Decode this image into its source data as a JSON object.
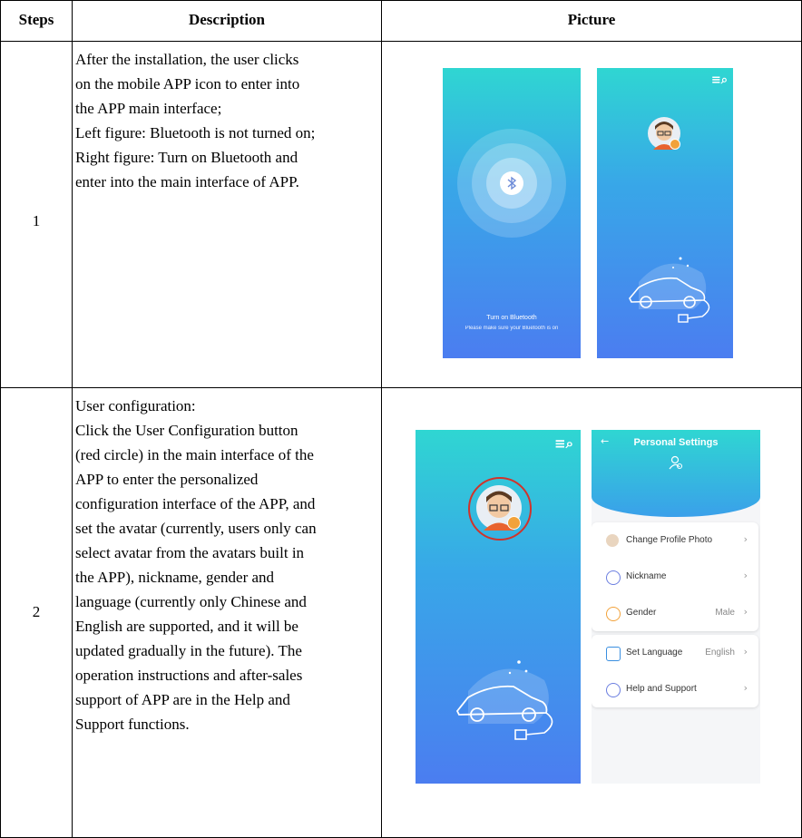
{
  "table": {
    "headers": {
      "steps": "Steps",
      "description": "Description",
      "picture": "Picture"
    },
    "rows": [
      {
        "step": "1",
        "description": "After the installation, the user clicks\non the mobile APP icon to enter into\nthe APP main interface;\nLeft figure: Bluetooth is not turned on;\nRight figure: Turn on Bluetooth and\nenter into the main interface of APP."
      },
      {
        "step": "2",
        "description": "User configuration:\nClick the User Configuration button\n(red circle) in the main interface of the\nAPP to enter the personalized\nconfiguration interface of the APP, and\nset the avatar (currently, users only can\nselect avatar from the avatars built in\nthe APP), nickname, gender and\nlanguage (currently only Chinese and\nEnglish are supported, and it will be\nupdated gradually in the future). The\noperation instructions and after-sales\nsupport of APP are in the Help and\nSupport functions."
      }
    ]
  },
  "screens": {
    "bluetooth_off": {
      "title": "Turn on Bluetooth",
      "subtitle": "Please make sure your Bluetooth is on"
    },
    "settings": {
      "title": "Personal Settings",
      "items": [
        {
          "label": "Change Profile Photo",
          "value": "",
          "icon": "avatar-icon"
        },
        {
          "label": "Nickname",
          "value": "",
          "icon": "user-icon"
        },
        {
          "label": "Gender",
          "value": "Male",
          "icon": "gender-icon"
        },
        {
          "label": "Set Language",
          "value": "English",
          "icon": "language-icon"
        },
        {
          "label": "Help and Support",
          "value": "",
          "icon": "help-icon"
        }
      ]
    }
  },
  "colors": {
    "accent_red": "#d0332b",
    "badge_orange": "#f2a23a"
  }
}
